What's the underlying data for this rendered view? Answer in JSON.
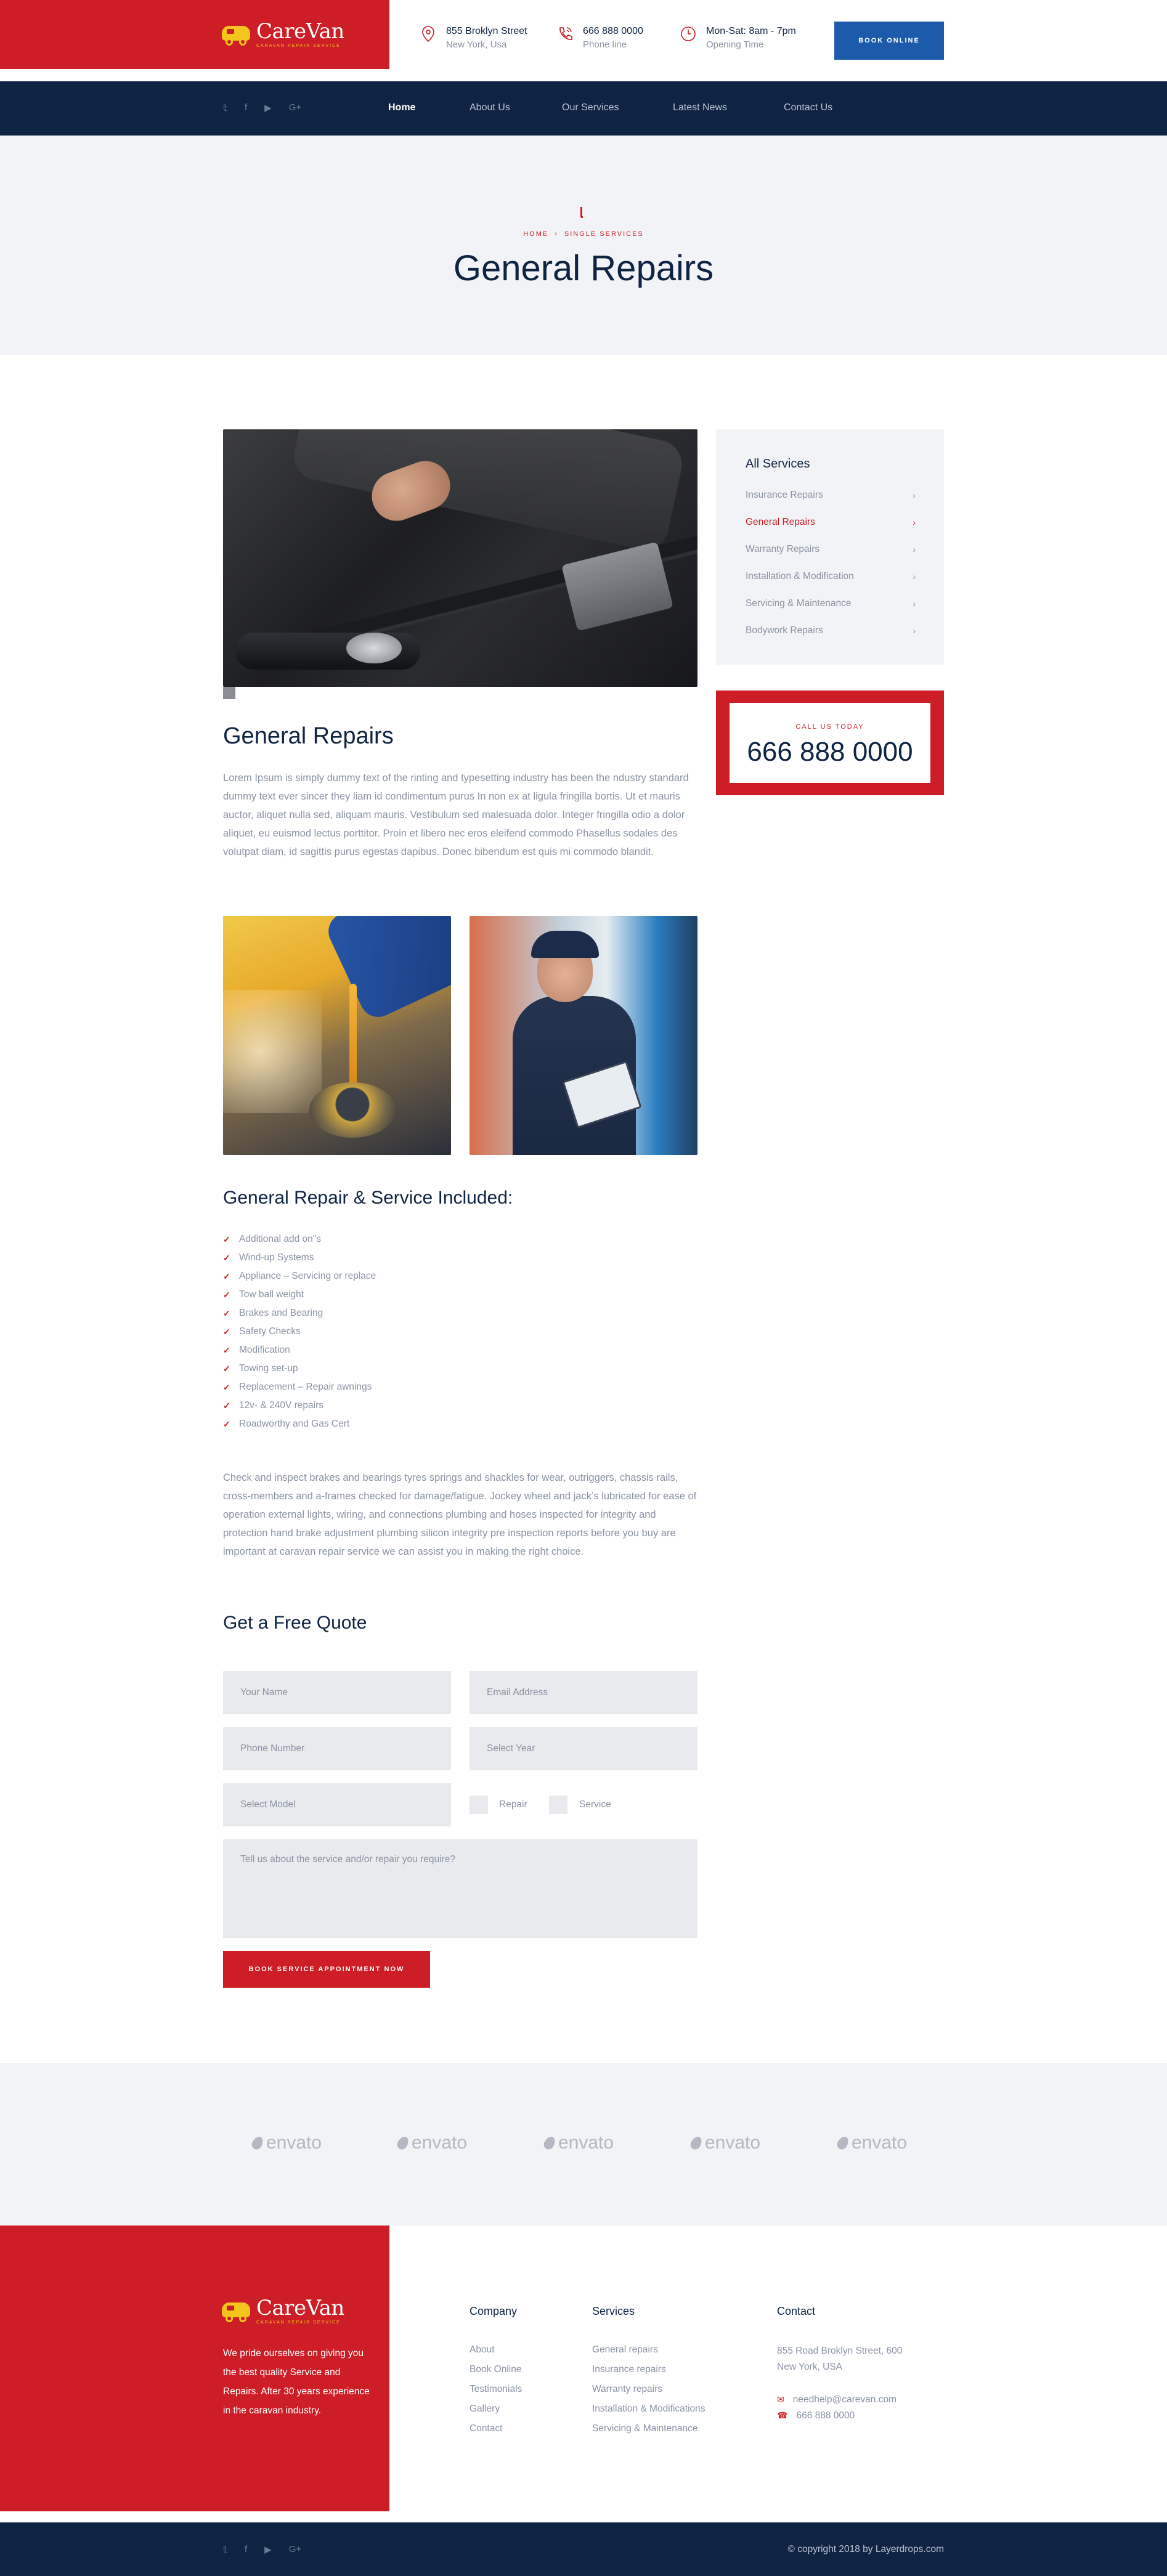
{
  "brand": {
    "name": "CareVan",
    "tagline": "CARAVAN REPAIR SERVICE"
  },
  "header": {
    "info": [
      {
        "icon": "map-pin-icon",
        "line1": "855 Broklyn Street",
        "line2": "New York, Usa"
      },
      {
        "icon": "phone-icon",
        "line1": "666 888 0000",
        "line2": "Phone line"
      },
      {
        "icon": "clock-icon",
        "line1": "Mon-Sat: 8am - 7pm",
        "line2": "Opening Time"
      }
    ],
    "book_online": "BOOK ONLINE"
  },
  "nav": {
    "social": [
      "twitter-icon",
      "facebook-icon",
      "youtube-icon",
      "google-plus-icon"
    ],
    "social_glyphs": [
      "𝕥",
      "f",
      "▶",
      "G+"
    ],
    "links": [
      "Home",
      "About Us",
      "Our Services",
      "Latest News",
      "Contact Us"
    ],
    "active": "Home"
  },
  "banner": {
    "crumb_home": "HOME",
    "crumb_current": "SINGLE SERVICES",
    "title": "General Repairs"
  },
  "main": {
    "title": "General Repairs",
    "intro": "Lorem Ipsum is simply dummy text of the rinting and typesetting industry has been the ndustry standard dummy text ever sincer they liam id condimentum purus In non ex at ligula fringilla bortis. Ut et mauris auctor, aliquet nulla sed, aliquam mauris. Vestibulum sed malesuada dolor. Integer fringilla odio a dolor aliquet, eu euismod lectus porttitor. Proin et libero nec eros eleifend commodo Phasellus sodales des volutpat diam, id sagittis purus egestas dapibus. Donec bibendum est quis mi commodo blandit.",
    "included_title": "General Repair & Service Included:",
    "included": [
      "Additional add on\"s",
      "Wind-up Systems",
      "Appliance – Servicing or replace",
      "Tow ball weight",
      "Brakes and Bearing",
      "Safety Checks",
      "Modification",
      "Towing set-up",
      "Replacement – Repair awnings",
      "12v- & 240V repairs",
      "Roadworthy and Gas Cert"
    ],
    "check_text": "Check and inspect brakes and bearings tyres springs and shackles for wear, outriggers, chassis rails, cross-members and a-frames checked for damage/fatigue. Jockey wheel and jack’s lubricated for ease of operation external lights, wiring, and connections plumbing and hoses inspected for integrity and protection hand brake adjustment plumbing silicon integrity pre inspection reports before you buy are important at caravan repair service we can assist you in making the right choice."
  },
  "sidebar": {
    "title": "All Services",
    "items": [
      {
        "label": "Insurance Repairs",
        "active": false
      },
      {
        "label": "General Repairs",
        "active": true
      },
      {
        "label": "Warranty Repairs",
        "active": false
      },
      {
        "label": "Installation & Modification",
        "active": false
      },
      {
        "label": "Servicing & Maintenance",
        "active": false
      },
      {
        "label": "Bodywork Repairs",
        "active": false
      }
    ],
    "call_label": "CALL US TODAY",
    "call_number": "666 888 0000"
  },
  "quote": {
    "title": "Get a Free Quote",
    "name_placeholder": "Your Name",
    "email_placeholder": "Email Address",
    "phone_placeholder": "Phone Number",
    "year_select": "Select Year",
    "model_select": "Select Model",
    "repair_label": "Repair",
    "service_label": "Service",
    "message_placeholder": "Tell us about the service and/or repair you require?",
    "submit": "BOOK SERVICE APPOINTMENT NOW"
  },
  "partners": [
    "envato",
    "envato",
    "envato",
    "envato",
    "envato"
  ],
  "footer": {
    "about": "We pride ourselves on giving you the best quality Service and Repairs. After 30 years experience in the caravan industry.",
    "company_title": "Company",
    "company": [
      "About",
      "Book Online",
      "Testimonials",
      "Gallery",
      "Contact"
    ],
    "services_title": "Services",
    "services": [
      "General repairs",
      "Insurance repairs",
      "Warranty repairs",
      "Installation & Modifications",
      "Servicing & Maintenance"
    ],
    "contact_title": "Contact",
    "address_line1": "855 Road Broklyn Street, 600",
    "address_line2": "New York, USA",
    "email": "needhelp@carevan.com",
    "phone": "666 888 0000",
    "copyright": "© copyright 2018 by Layerdrops.com"
  },
  "colors": {
    "red": "#cd1d26",
    "navy": "#0e2442",
    "blue": "#1c5bab",
    "yellow": "#f4c51c"
  }
}
